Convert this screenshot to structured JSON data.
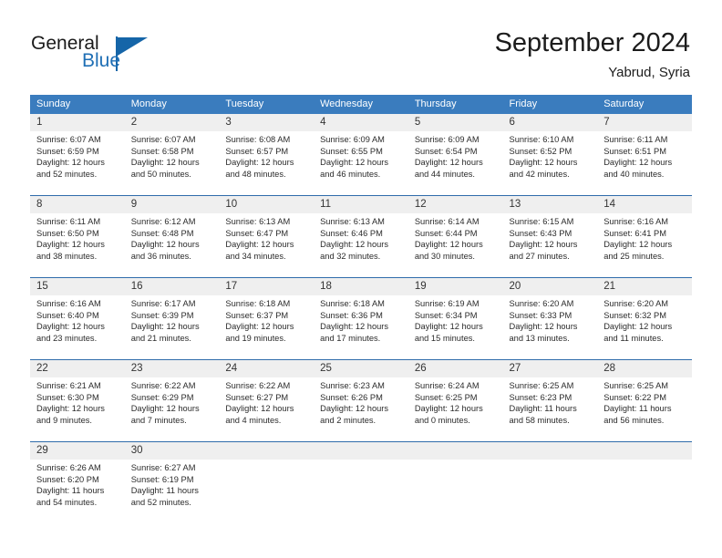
{
  "brand": {
    "line1": "General",
    "line2": "Blue",
    "accent_color": "#1565a8"
  },
  "header": {
    "title": "September 2024",
    "location": "Yabrud, Syria"
  },
  "colors": {
    "header_band": "#3a7cbe",
    "row_divider": "#2f6cab",
    "day_number_strip": "#efefef",
    "text": "#2b2b2b"
  },
  "weekday_headers": [
    "Sunday",
    "Monday",
    "Tuesday",
    "Wednesday",
    "Thursday",
    "Friday",
    "Saturday"
  ],
  "weeks": [
    {
      "days": [
        {
          "num": "1",
          "sunrise": "Sunrise: 6:07 AM",
          "sunset": "Sunset: 6:59 PM",
          "daylight1": "Daylight: 12 hours",
          "daylight2": "and 52 minutes."
        },
        {
          "num": "2",
          "sunrise": "Sunrise: 6:07 AM",
          "sunset": "Sunset: 6:58 PM",
          "daylight1": "Daylight: 12 hours",
          "daylight2": "and 50 minutes."
        },
        {
          "num": "3",
          "sunrise": "Sunrise: 6:08 AM",
          "sunset": "Sunset: 6:57 PM",
          "daylight1": "Daylight: 12 hours",
          "daylight2": "and 48 minutes."
        },
        {
          "num": "4",
          "sunrise": "Sunrise: 6:09 AM",
          "sunset": "Sunset: 6:55 PM",
          "daylight1": "Daylight: 12 hours",
          "daylight2": "and 46 minutes."
        },
        {
          "num": "5",
          "sunrise": "Sunrise: 6:09 AM",
          "sunset": "Sunset: 6:54 PM",
          "daylight1": "Daylight: 12 hours",
          "daylight2": "and 44 minutes."
        },
        {
          "num": "6",
          "sunrise": "Sunrise: 6:10 AM",
          "sunset": "Sunset: 6:52 PM",
          "daylight1": "Daylight: 12 hours",
          "daylight2": "and 42 minutes."
        },
        {
          "num": "7",
          "sunrise": "Sunrise: 6:11 AM",
          "sunset": "Sunset: 6:51 PM",
          "daylight1": "Daylight: 12 hours",
          "daylight2": "and 40 minutes."
        }
      ]
    },
    {
      "days": [
        {
          "num": "8",
          "sunrise": "Sunrise: 6:11 AM",
          "sunset": "Sunset: 6:50 PM",
          "daylight1": "Daylight: 12 hours",
          "daylight2": "and 38 minutes."
        },
        {
          "num": "9",
          "sunrise": "Sunrise: 6:12 AM",
          "sunset": "Sunset: 6:48 PM",
          "daylight1": "Daylight: 12 hours",
          "daylight2": "and 36 minutes."
        },
        {
          "num": "10",
          "sunrise": "Sunrise: 6:13 AM",
          "sunset": "Sunset: 6:47 PM",
          "daylight1": "Daylight: 12 hours",
          "daylight2": "and 34 minutes."
        },
        {
          "num": "11",
          "sunrise": "Sunrise: 6:13 AM",
          "sunset": "Sunset: 6:46 PM",
          "daylight1": "Daylight: 12 hours",
          "daylight2": "and 32 minutes."
        },
        {
          "num": "12",
          "sunrise": "Sunrise: 6:14 AM",
          "sunset": "Sunset: 6:44 PM",
          "daylight1": "Daylight: 12 hours",
          "daylight2": "and 30 minutes."
        },
        {
          "num": "13",
          "sunrise": "Sunrise: 6:15 AM",
          "sunset": "Sunset: 6:43 PM",
          "daylight1": "Daylight: 12 hours",
          "daylight2": "and 27 minutes."
        },
        {
          "num": "14",
          "sunrise": "Sunrise: 6:16 AM",
          "sunset": "Sunset: 6:41 PM",
          "daylight1": "Daylight: 12 hours",
          "daylight2": "and 25 minutes."
        }
      ]
    },
    {
      "days": [
        {
          "num": "15",
          "sunrise": "Sunrise: 6:16 AM",
          "sunset": "Sunset: 6:40 PM",
          "daylight1": "Daylight: 12 hours",
          "daylight2": "and 23 minutes."
        },
        {
          "num": "16",
          "sunrise": "Sunrise: 6:17 AM",
          "sunset": "Sunset: 6:39 PM",
          "daylight1": "Daylight: 12 hours",
          "daylight2": "and 21 minutes."
        },
        {
          "num": "17",
          "sunrise": "Sunrise: 6:18 AM",
          "sunset": "Sunset: 6:37 PM",
          "daylight1": "Daylight: 12 hours",
          "daylight2": "and 19 minutes."
        },
        {
          "num": "18",
          "sunrise": "Sunrise: 6:18 AM",
          "sunset": "Sunset: 6:36 PM",
          "daylight1": "Daylight: 12 hours",
          "daylight2": "and 17 minutes."
        },
        {
          "num": "19",
          "sunrise": "Sunrise: 6:19 AM",
          "sunset": "Sunset: 6:34 PM",
          "daylight1": "Daylight: 12 hours",
          "daylight2": "and 15 minutes."
        },
        {
          "num": "20",
          "sunrise": "Sunrise: 6:20 AM",
          "sunset": "Sunset: 6:33 PM",
          "daylight1": "Daylight: 12 hours",
          "daylight2": "and 13 minutes."
        },
        {
          "num": "21",
          "sunrise": "Sunrise: 6:20 AM",
          "sunset": "Sunset: 6:32 PM",
          "daylight1": "Daylight: 12 hours",
          "daylight2": "and 11 minutes."
        }
      ]
    },
    {
      "days": [
        {
          "num": "22",
          "sunrise": "Sunrise: 6:21 AM",
          "sunset": "Sunset: 6:30 PM",
          "daylight1": "Daylight: 12 hours",
          "daylight2": "and 9 minutes."
        },
        {
          "num": "23",
          "sunrise": "Sunrise: 6:22 AM",
          "sunset": "Sunset: 6:29 PM",
          "daylight1": "Daylight: 12 hours",
          "daylight2": "and 7 minutes."
        },
        {
          "num": "24",
          "sunrise": "Sunrise: 6:22 AM",
          "sunset": "Sunset: 6:27 PM",
          "daylight1": "Daylight: 12 hours",
          "daylight2": "and 4 minutes."
        },
        {
          "num": "25",
          "sunrise": "Sunrise: 6:23 AM",
          "sunset": "Sunset: 6:26 PM",
          "daylight1": "Daylight: 12 hours",
          "daylight2": "and 2 minutes."
        },
        {
          "num": "26",
          "sunrise": "Sunrise: 6:24 AM",
          "sunset": "Sunset: 6:25 PM",
          "daylight1": "Daylight: 12 hours",
          "daylight2": "and 0 minutes."
        },
        {
          "num": "27",
          "sunrise": "Sunrise: 6:25 AM",
          "sunset": "Sunset: 6:23 PM",
          "daylight1": "Daylight: 11 hours",
          "daylight2": "and 58 minutes."
        },
        {
          "num": "28",
          "sunrise": "Sunrise: 6:25 AM",
          "sunset": "Sunset: 6:22 PM",
          "daylight1": "Daylight: 11 hours",
          "daylight2": "and 56 minutes."
        }
      ]
    },
    {
      "days": [
        {
          "num": "29",
          "sunrise": "Sunrise: 6:26 AM",
          "sunset": "Sunset: 6:20 PM",
          "daylight1": "Daylight: 11 hours",
          "daylight2": "and 54 minutes."
        },
        {
          "num": "30",
          "sunrise": "Sunrise: 6:27 AM",
          "sunset": "Sunset: 6:19 PM",
          "daylight1": "Daylight: 11 hours",
          "daylight2": "and 52 minutes."
        },
        {
          "num": "",
          "sunrise": "",
          "sunset": "",
          "daylight1": "",
          "daylight2": ""
        },
        {
          "num": "",
          "sunrise": "",
          "sunset": "",
          "daylight1": "",
          "daylight2": ""
        },
        {
          "num": "",
          "sunrise": "",
          "sunset": "",
          "daylight1": "",
          "daylight2": ""
        },
        {
          "num": "",
          "sunrise": "",
          "sunset": "",
          "daylight1": "",
          "daylight2": ""
        },
        {
          "num": "",
          "sunrise": "",
          "sunset": "",
          "daylight1": "",
          "daylight2": ""
        }
      ]
    }
  ]
}
